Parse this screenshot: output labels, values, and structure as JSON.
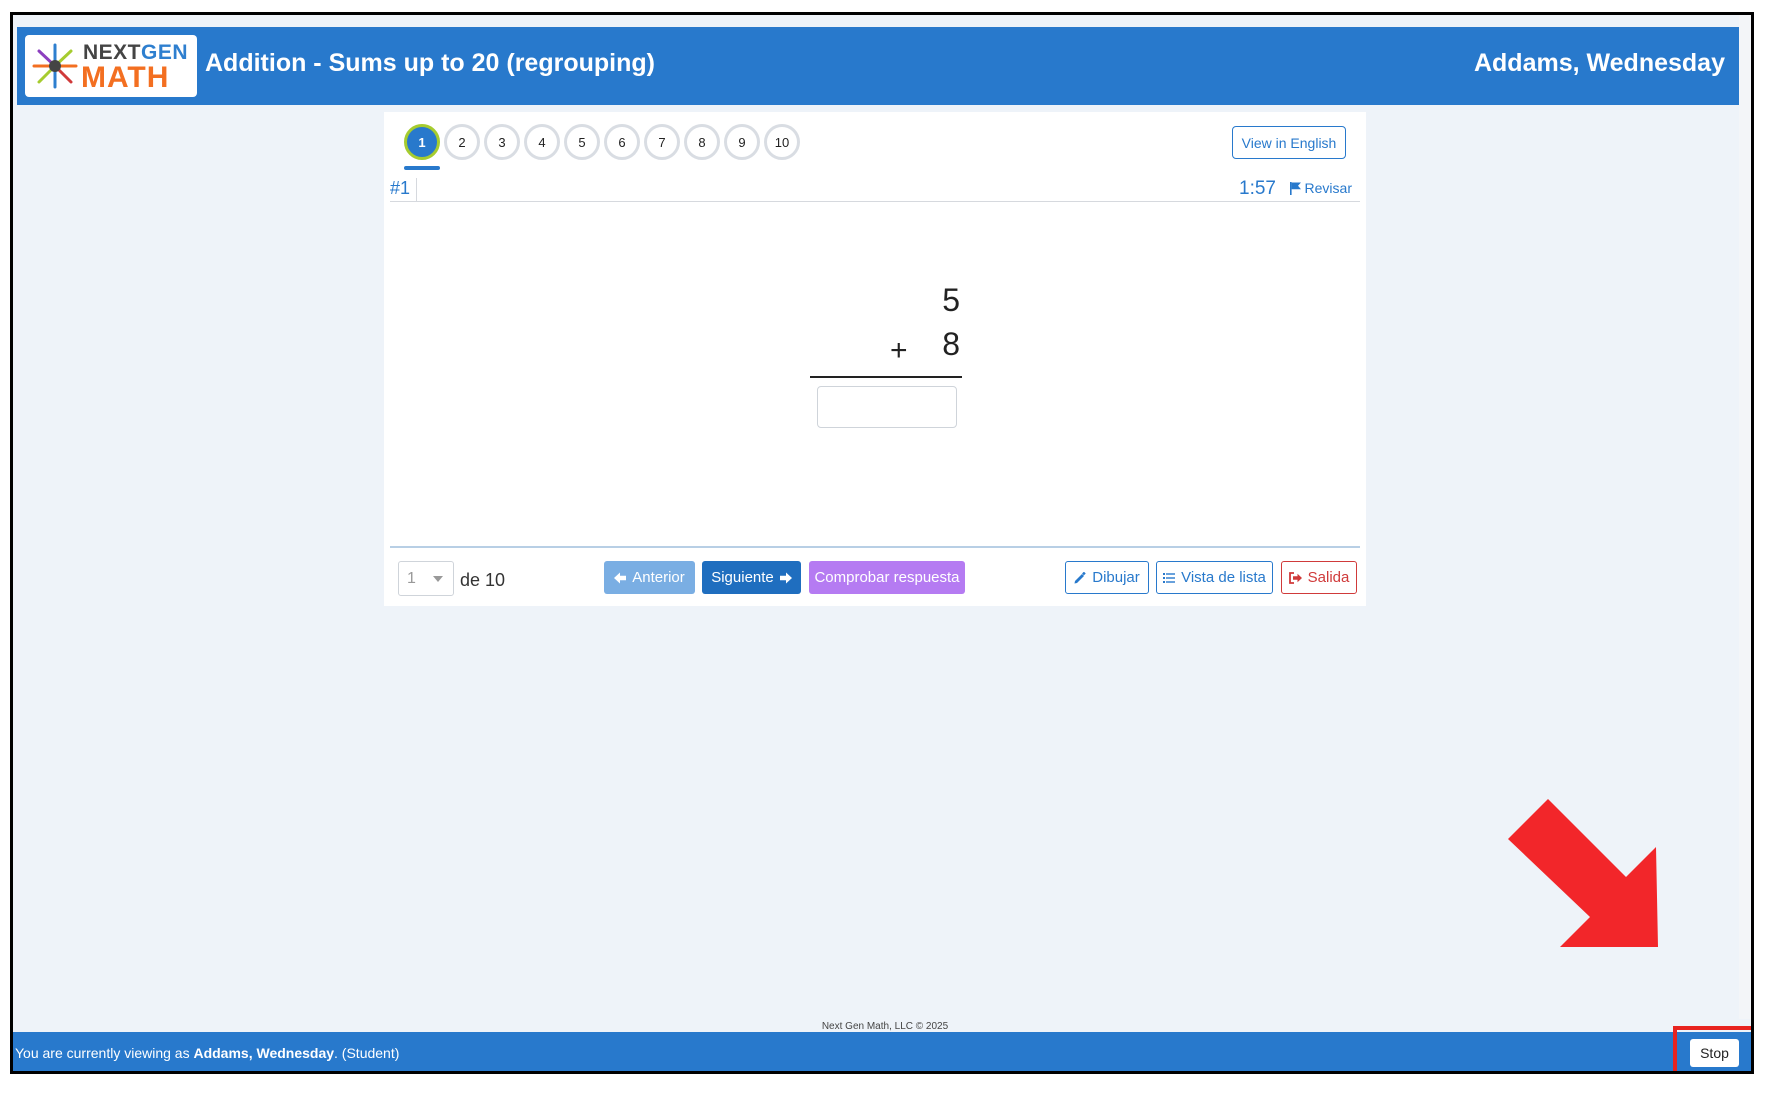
{
  "header": {
    "logo_line1_a": "NEXT",
    "logo_line1_b": "GEN",
    "logo_line2": "MATH",
    "title": "Addition - Sums up to 20 (regrouping)",
    "user": "Addams, Wednesday"
  },
  "question_nav": {
    "items": [
      "1",
      "2",
      "3",
      "4",
      "5",
      "6",
      "7",
      "8",
      "9",
      "10"
    ],
    "active_index": 0,
    "view_english_label": "View in English"
  },
  "question": {
    "number_label": "#1",
    "timer": "1:57",
    "review_label": "Revisar",
    "top_operand": "5",
    "operator": "+",
    "bottom_operand": "8",
    "answer_value": ""
  },
  "footer_controls": {
    "selected_question": "1",
    "of_label": "de 10",
    "prev_label": "Anterior",
    "next_label": "Siguiente",
    "check_label": "Comprobar respuesta",
    "draw_label": "Dibujar",
    "list_label": "Vista de lista",
    "exit_label": "Salida"
  },
  "page_footer": {
    "copyright": "Next Gen Math, LLC © 2025"
  },
  "view_bar": {
    "prefix": "You are currently viewing as ",
    "user": "Addams, Wednesday",
    "suffix": ". (Student)",
    "stop_label": "Stop"
  },
  "colors": {
    "brand_blue": "#2879cc",
    "accent_green": "#a6cc2f",
    "purple": "#b57bf2",
    "danger": "#d03a3a",
    "annotation_red": "#e8231f"
  }
}
